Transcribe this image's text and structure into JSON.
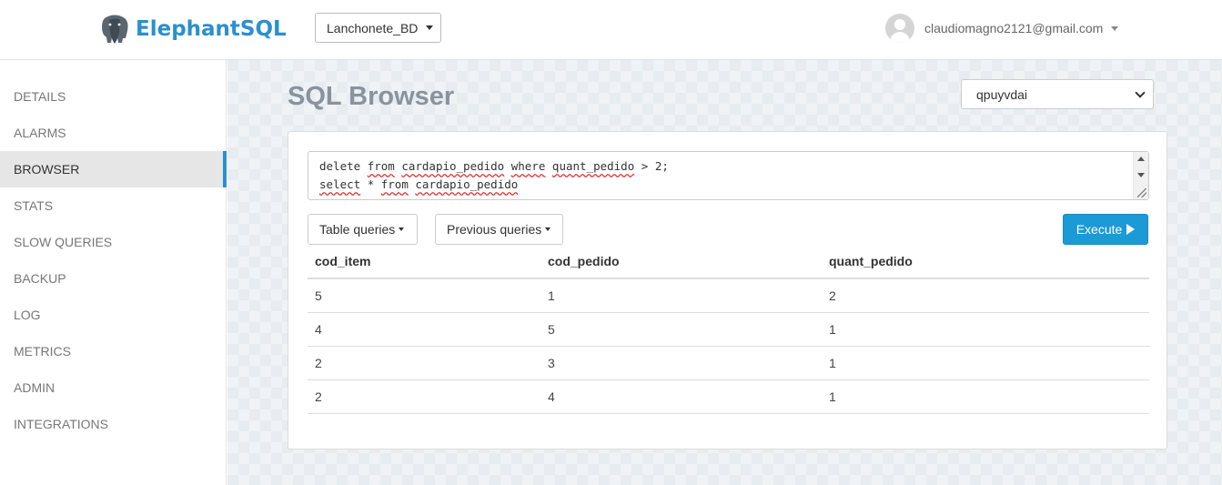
{
  "header": {
    "logo_text": "ElephantSQL",
    "instance": "Lanchonete_BD",
    "user_email": "claudiomagno2121@gmail.com"
  },
  "sidebar": {
    "items": [
      {
        "label": "DETAILS"
      },
      {
        "label": "ALARMS"
      },
      {
        "label": "BROWSER"
      },
      {
        "label": "STATS"
      },
      {
        "label": "SLOW QUERIES"
      },
      {
        "label": "BACKUP"
      },
      {
        "label": "LOG"
      },
      {
        "label": "METRICS"
      },
      {
        "label": "ADMIN"
      },
      {
        "label": "INTEGRATIONS"
      }
    ],
    "active": "BROWSER"
  },
  "main": {
    "title": "SQL Browser",
    "database_select": "qpuyvdai",
    "editor": {
      "line1": {
        "delete": "delete",
        "from": "from",
        "table": "cardapio_pedido",
        "where": "where",
        "column": "quant_pedido",
        "rest": "> 2;"
      },
      "line2": {
        "select": "select",
        "star": "*",
        "from": "from",
        "table": "cardapio_pedido"
      }
    },
    "buttons": {
      "table_queries": "Table queries",
      "previous_queries": "Previous queries",
      "execute": "Execute"
    },
    "results": {
      "columns": [
        "cod_item",
        "cod_pedido",
        "quant_pedido"
      ],
      "rows": [
        [
          "5",
          "1",
          "2"
        ],
        [
          "4",
          "5",
          "1"
        ],
        [
          "2",
          "3",
          "1"
        ],
        [
          "2",
          "4",
          "1"
        ]
      ]
    }
  },
  "colors": {
    "brand": "#2b8fcf",
    "execute_button": "#1c9ad6",
    "active_nav_border": "#2b8fcf"
  }
}
